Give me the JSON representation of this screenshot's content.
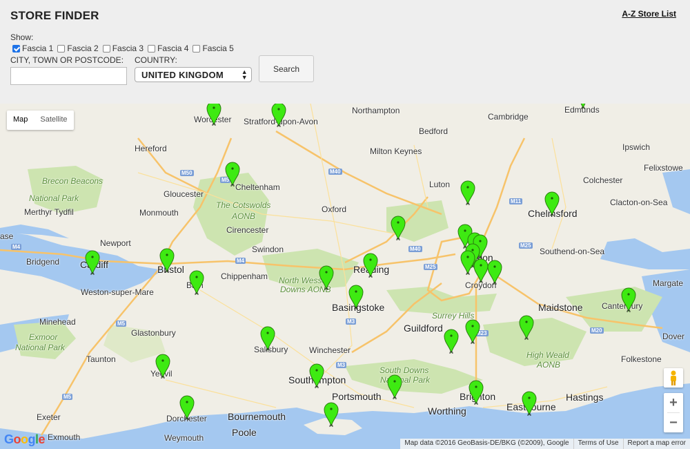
{
  "header": {
    "title": "STORE FINDER",
    "az_link": "A-Z Store List",
    "show_label": "Show:",
    "fascia": [
      {
        "label": "Fascia 1",
        "checked": true
      },
      {
        "label": "Fascia 2",
        "checked": false
      },
      {
        "label": "Fascia 3",
        "checked": false
      },
      {
        "label": "Fascia 4",
        "checked": false
      },
      {
        "label": "Fascia 5",
        "checked": false
      }
    ],
    "city_label": "CITY, TOWN OR POSTCODE:",
    "city_value": "",
    "country_label": "COUNTRY:",
    "country_value": "UNITED KINGDOM",
    "search_label": "Search"
  },
  "map": {
    "maptype": {
      "map": "Map",
      "satellite": "Satellite"
    },
    "zoom_in": "+",
    "zoom_out": "−",
    "logo": "Google",
    "attribution": {
      "data": "Map data ©2016 GeoBasis-DE/BKG (©2009), Google",
      "terms": "Terms of Use",
      "report": "Report a map error"
    },
    "places": [
      "Northampton",
      "Cambridge",
      "Edmunds",
      "Worcester",
      "Stratford-upon-Avon",
      "Bedford",
      "Milton Keynes",
      "Hereford",
      "Ipswich",
      "Felixstowe",
      "Brecon Beacons",
      "National Park",
      "Cheltenham",
      "Gloucester",
      "Luton",
      "Colchester",
      "Merthyr Tydfil",
      "Monmouth",
      "The Cotswolds",
      "AONB",
      "Oxford",
      "Chelmsford",
      "Clacton-on-Sea",
      "Cirencester",
      "Newport",
      "Swindon",
      "Southend-on-Sea",
      "Bridgend",
      "Cardiff",
      "Bristol",
      "Chippenham",
      "Reading",
      "London",
      "Weston-super-Mare",
      "Bath",
      "North Wessex",
      "Downs AONB",
      "Croydon",
      "Margate",
      "Basingstoke",
      "Maidstone",
      "Canterbury",
      "Minehead",
      "Surrey Hills",
      "Glastonbury",
      "Exmoor",
      "National Park",
      "Winchester",
      "Guildford",
      "Dover",
      "Taunton",
      "Salisbury",
      "High Weald",
      "AONB",
      "Folkestone",
      "Yeovil",
      "Southampton",
      "South Downs",
      "National Park",
      "Portsmouth",
      "Brighton",
      "Hastings",
      "Exeter",
      "Dorchester",
      "Bournemouth",
      "Worthing",
      "Eastbourne",
      "Weymouth",
      "Poole",
      "Exmouth",
      "ase"
    ],
    "roads": [
      "M40",
      "M50",
      "M5",
      "M11",
      "M4",
      "M25",
      "M40",
      "M4",
      "M25",
      "M3",
      "M20",
      "M5",
      "M23",
      "M5",
      "M3"
    ],
    "colors": {
      "land": "#f0eee6",
      "water": "#a4c8f0",
      "park": "#cde4b0",
      "marker": "#3eea12"
    }
  }
}
